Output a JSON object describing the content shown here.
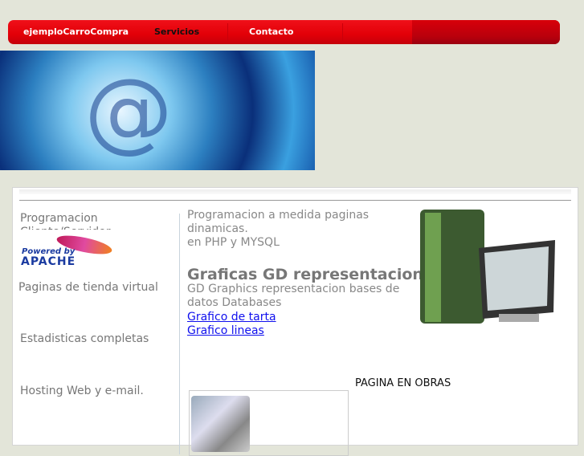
{
  "nav": {
    "items": [
      "ejemploCarroCompra",
      "Servicios",
      "Contacto"
    ]
  },
  "sidebar": {
    "items": [
      "Programacion Cliente/Servidor",
      "Paginas de tienda virtual",
      "Estadisticas completas",
      "Hosting Web y e-mail."
    ],
    "apache_logo": "Powered by APACHE"
  },
  "main": {
    "intro1": "Programacion a medida paginas dinamicas.",
    "intro2": "en PHP y MYSQL",
    "heading": "Graficas GD representacion",
    "desc": "GD Graphics representacion bases de datos Databases",
    "links": [
      "Grafico de tarta ",
      "Grafico lineas "
    ],
    "obras": "PAGINA EN OBRAS"
  }
}
